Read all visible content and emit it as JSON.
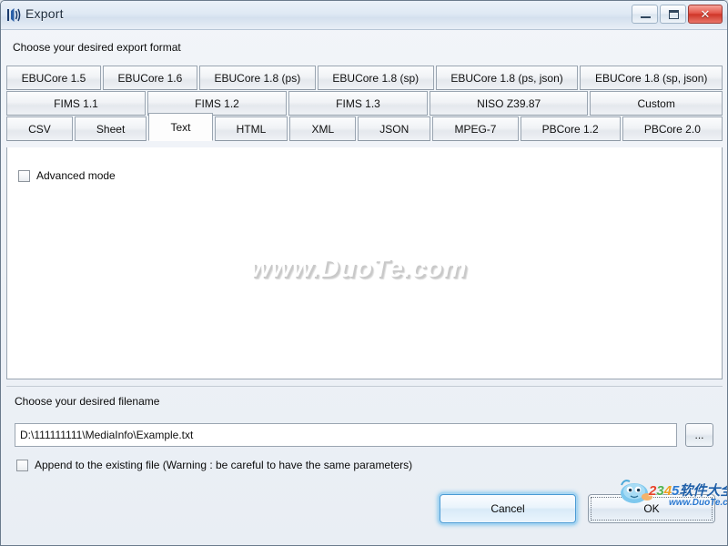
{
  "window": {
    "title": "Export",
    "icon": "sound-wave-icon",
    "controls": {
      "minimize": "Minimize",
      "maximize": "Maximize",
      "close": "Close",
      "close_glyph": "✕"
    }
  },
  "format_section": {
    "label": "Choose your desired export format",
    "tab_rows": [
      {
        "row_index": 0,
        "tabs": [
          {
            "label": "EBUCore 1.5",
            "selected": false
          },
          {
            "label": "EBUCore 1.6",
            "selected": false
          },
          {
            "label": "EBUCore 1.8 (ps)",
            "selected": false
          },
          {
            "label": "EBUCore 1.8 (sp)",
            "selected": false
          },
          {
            "label": "EBUCore 1.8 (ps, json)",
            "selected": false
          },
          {
            "label": "EBUCore 1.8 (sp, json)",
            "selected": false
          }
        ]
      },
      {
        "row_index": 1,
        "tabs": [
          {
            "label": "FIMS 1.1",
            "selected": false
          },
          {
            "label": "FIMS 1.2",
            "selected": false
          },
          {
            "label": "FIMS 1.3",
            "selected": false
          },
          {
            "label": "NISO Z39.87",
            "selected": false
          },
          {
            "label": "Custom",
            "selected": false
          }
        ]
      },
      {
        "row_index": 2,
        "tabs": [
          {
            "label": "CSV",
            "selected": false
          },
          {
            "label": "Sheet",
            "selected": false
          },
          {
            "label": "Text",
            "selected": true
          },
          {
            "label": "HTML",
            "selected": false
          },
          {
            "label": "XML",
            "selected": false
          },
          {
            "label": "JSON",
            "selected": false
          },
          {
            "label": "MPEG-7",
            "selected": false
          },
          {
            "label": "PBCore 1.2",
            "selected": false
          },
          {
            "label": "PBCore 2.0",
            "selected": false
          }
        ]
      }
    ]
  },
  "panel": {
    "advanced_mode": {
      "label": "Advanced mode",
      "checked": false
    },
    "watermark": "www.DuoTe.com"
  },
  "filename_section": {
    "label": "Choose your desired filename",
    "path_value": "D:\\111111111\\MediaInfo\\Example.txt",
    "path_placeholder": "",
    "browse_label": "...",
    "append": {
      "label": "Append to the existing file (Warning : be careful to have the same parameters)",
      "checked": false
    }
  },
  "buttons": {
    "cancel": "Cancel",
    "ok": "OK"
  },
  "overlay_logo": {
    "brand_parts": [
      "2",
      "3",
      "4",
      "5",
      "软件大全"
    ],
    "site": "www.DuoTe.com"
  },
  "colors": {
    "close_red": "#cf3628",
    "focus_blue": "#4a9ad4",
    "panel_white": "#ffffff",
    "titlebar_blue": "#d4e0ee"
  }
}
